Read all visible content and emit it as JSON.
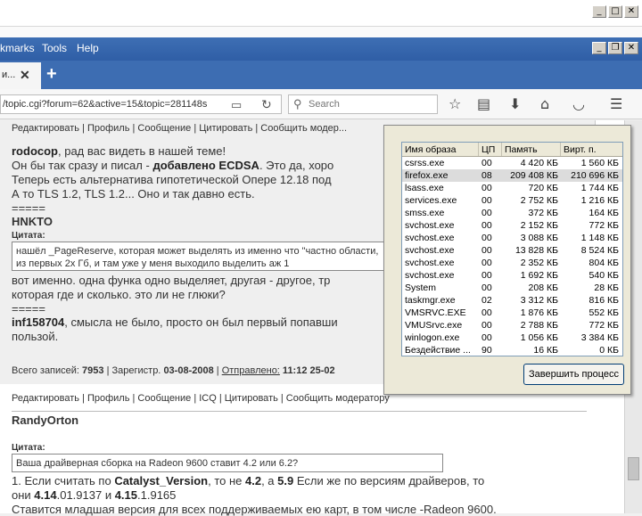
{
  "window": {
    "minimize": "_",
    "maximize": "□",
    "close": "✕"
  },
  "menubar": {
    "items": [
      "kmarks",
      "Tools",
      "Help"
    ]
  },
  "inner_window": {
    "minimize": "_",
    "restore": "❐",
    "close": "✕"
  },
  "tab": {
    "label": "и...",
    "close": "✕",
    "new_tab": "+"
  },
  "navbar": {
    "url": "/topic.cgi?forum=62&active=15&topic=281148s",
    "search_placeholder": "Search"
  },
  "post1": {
    "actions": "Редактировать | Профиль | Сообщение | Цитировать | Сообщить модер...",
    "greeting_name": "rodocop",
    "greeting_text": ", рад вас видеть в нашей теме!",
    "line2_pre": "Он бы так сразу и писал - ",
    "line2_bold": "добавлено ECDSA",
    "line2_post": ". Это да, хоро",
    "line3": "Теперь есть альтернатива гипотетической Опере 12.18 под",
    "line4": "А то TLS 1.2, TLS 1.2... Оно и так давно есть.",
    "sep1": "=====",
    "name2": "HNKTO",
    "quote_label": "Цитата:",
    "quote_text": "нашёл _PageReserve, которая может выделять из именно что \"частно области, из первых 2х Гб, и там уже у меня выходило выделить аж 1",
    "line5": "вот именно. одна функа одно выделяет, другая - другое, тр",
    "line6": "которая где и сколько. это ли не глюки?",
    "sep2": "=====",
    "name3": "inf158704",
    "line7": ", смысла не было, просто он был первый попавши",
    "line8": "пользой.",
    "stats_label1": "Всего записей: ",
    "stats_posts": "7953",
    "stats_label2": " | Зарегистр. ",
    "stats_reg": "03-08-2008",
    "stats_label3": " | ",
    "stats_sent": "Отправлено:",
    "stats_time": " 11:12 25-02"
  },
  "post2": {
    "actions": "Редактировать | Профиль | Сообщение | ICQ | Цитировать | Сообщить модератору",
    "author": "RandyOrton",
    "quote_label": "Цитата:",
    "quote_text": "Ваша драйверная сборка на Radeon 9600 ставит 4.2 или 6.2?",
    "line1_a": "1. Если считать по ",
    "line1_b": "Catalyst_Version",
    "line1_c": ", то не ",
    "line1_d": "4.2",
    "line1_e": ", а ",
    "line1_f": "5.9",
    "line1_g": " Если же по версиям драйверов, то",
    "line2_a": "они ",
    "line2_b": "4.14",
    "line2_c": ".01.9137 и ",
    "line2_d": "4.15",
    "line2_e": ".1.9165",
    "line3": "Ставится младшая версия для всех поддерживаемых ею карт, в том числе -Radeon 9600."
  },
  "taskmgr": {
    "headers": [
      "Имя образа",
      "ЦП",
      "Память",
      "Вирт. п."
    ],
    "rows": [
      {
        "name": "csrss.exe",
        "cpu": "00",
        "mem": "4 420 КБ",
        "virt": "1 560 КБ"
      },
      {
        "name": "firefox.exe",
        "cpu": "08",
        "mem": "209 408 КБ",
        "virt": "210 696 КБ"
      },
      {
        "name": "lsass.exe",
        "cpu": "00",
        "mem": "720 КБ",
        "virt": "1 744 КБ"
      },
      {
        "name": "services.exe",
        "cpu": "00",
        "mem": "2 752 КБ",
        "virt": "1 216 КБ"
      },
      {
        "name": "smss.exe",
        "cpu": "00",
        "mem": "372 КБ",
        "virt": "164 КБ"
      },
      {
        "name": "svchost.exe",
        "cpu": "00",
        "mem": "2 152 КБ",
        "virt": "772 КБ"
      },
      {
        "name": "svchost.exe",
        "cpu": "00",
        "mem": "3 088 КБ",
        "virt": "1 148 КБ"
      },
      {
        "name": "svchost.exe",
        "cpu": "00",
        "mem": "13 828 КБ",
        "virt": "8 524 КБ"
      },
      {
        "name": "svchost.exe",
        "cpu": "00",
        "mem": "2 352 КБ",
        "virt": "804 КБ"
      },
      {
        "name": "svchost.exe",
        "cpu": "00",
        "mem": "1 692 КБ",
        "virt": "540 КБ"
      },
      {
        "name": "System",
        "cpu": "00",
        "mem": "208 КБ",
        "virt": "28 КБ"
      },
      {
        "name": "taskmgr.exe",
        "cpu": "02",
        "mem": "3 312 КБ",
        "virt": "816 КБ"
      },
      {
        "name": "VMSRVC.EXE",
        "cpu": "00",
        "mem": "1 876 КБ",
        "virt": "552 КБ"
      },
      {
        "name": "VMUSrvc.exe",
        "cpu": "00",
        "mem": "2 788 КБ",
        "virt": "772 КБ"
      },
      {
        "name": "winlogon.exe",
        "cpu": "00",
        "mem": "1 056 КБ",
        "virt": "3 384 КБ"
      },
      {
        "name": "Бездействие ...",
        "cpu": "90",
        "mem": "16 КБ",
        "virt": "0 КБ"
      }
    ],
    "end_button": "Завершить процесс"
  }
}
